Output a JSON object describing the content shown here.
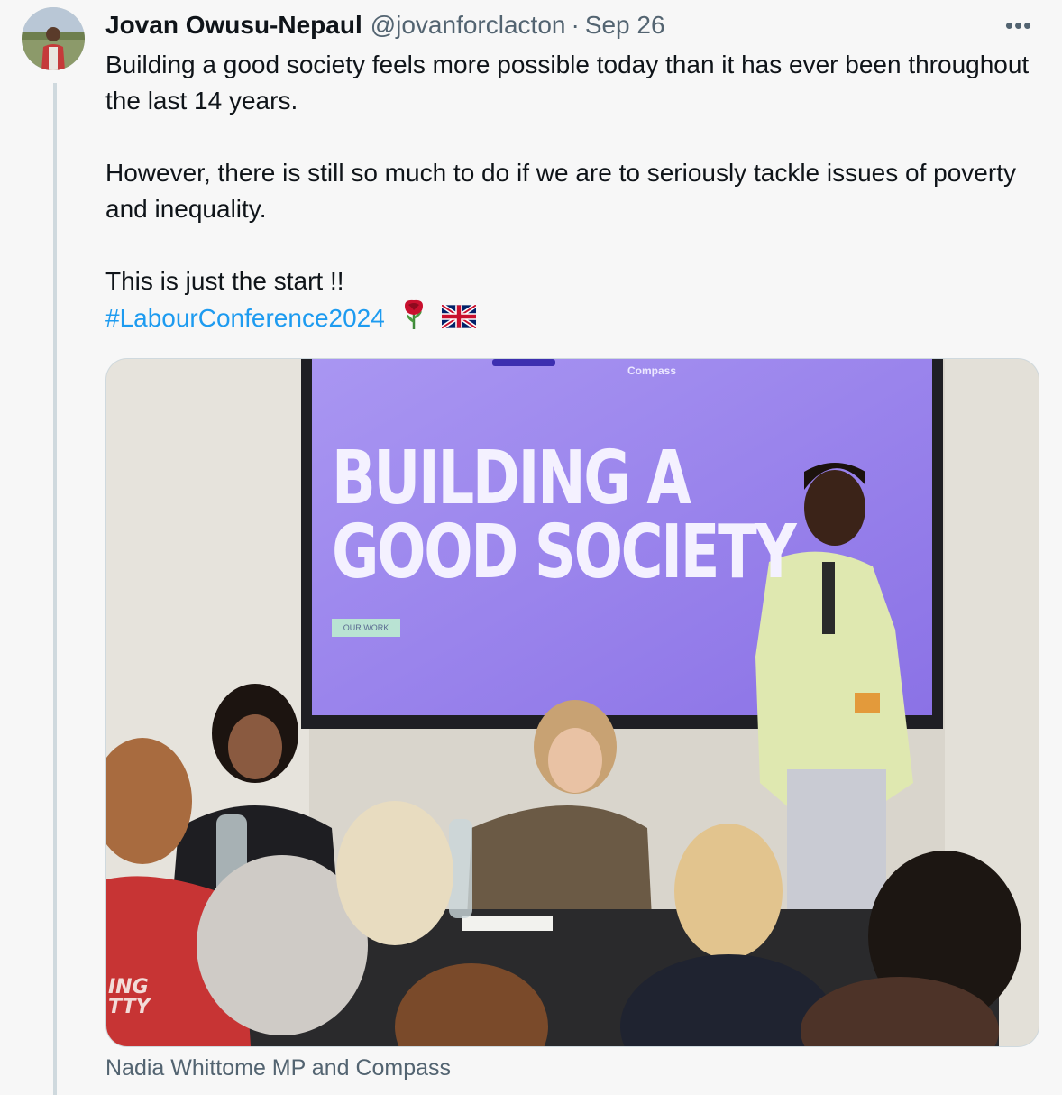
{
  "tweet": {
    "author_name": "Jovan Owusu-Nepaul",
    "handle": "@jovanforclacton",
    "separator": "·",
    "date": "Sep 26",
    "more_label": "•••",
    "lines": [
      "Building a good society feels more possible today than it has ever been throughout the last 14 years.",
      "However, there is still so much to do if we are to seriously tackle issues of poverty and inequality.",
      "This is just the start !!"
    ],
    "hashtag": "#LabourConference2024",
    "emojis": [
      "rose-icon",
      "uk-flag-icon"
    ]
  },
  "media": {
    "screen_title_line1": "BUILDING A",
    "screen_title_line2": "GOOD SOCIETY",
    "screen_brand": "Compass",
    "screen_button": "OUR WORK",
    "shirt_text_line1": "ING",
    "shirt_text_line2": "TTY",
    "caption": "Nadia Whittome MP and Compass"
  },
  "colors": {
    "link": "#1d9bf0",
    "secondary_text": "#536471",
    "screen_purple": "#9b83ec"
  }
}
